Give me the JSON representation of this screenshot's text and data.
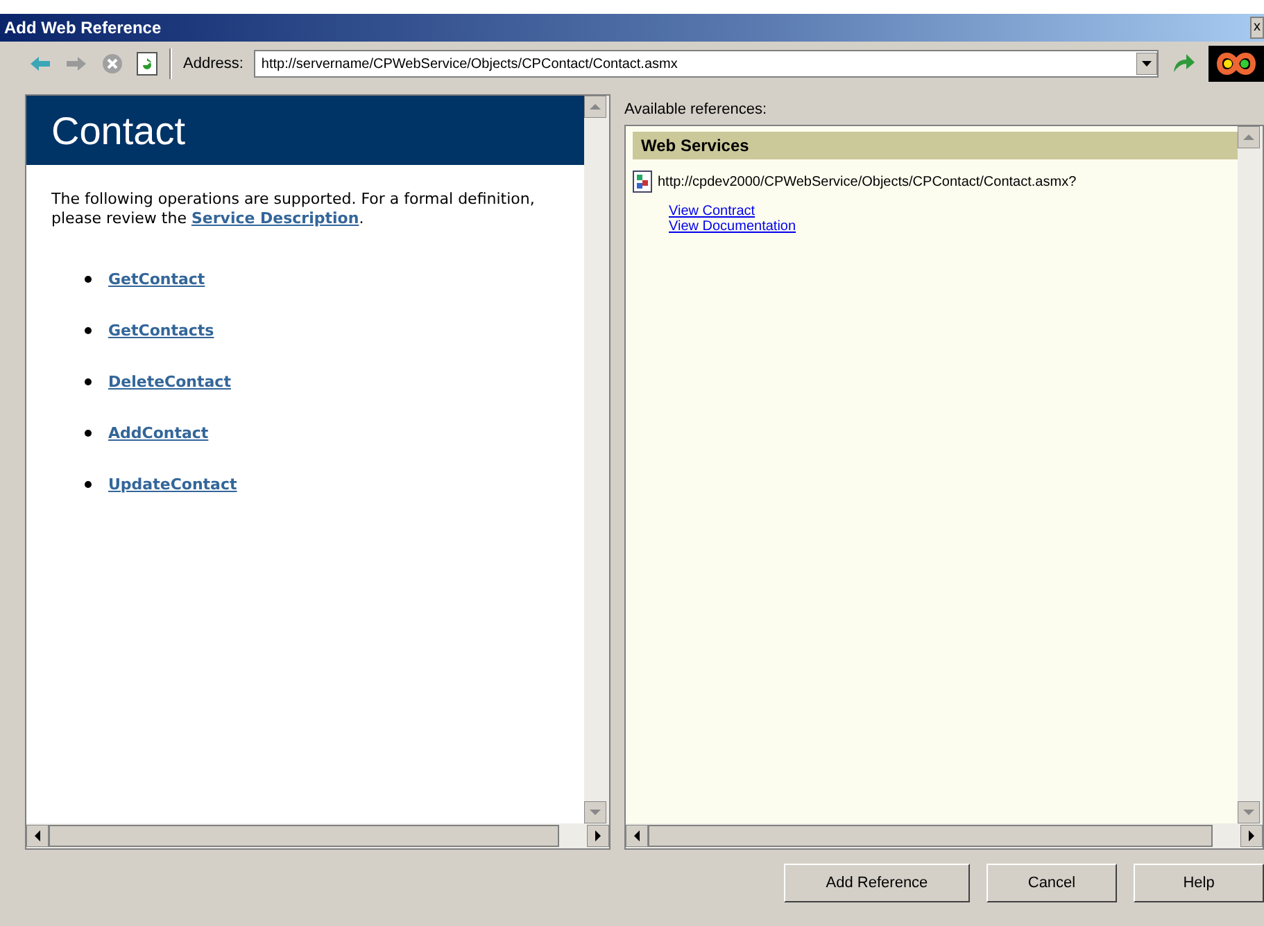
{
  "window": {
    "title": "Add Web Reference",
    "close": "x"
  },
  "toolbar": {
    "address_label": "Address:",
    "address": "http://servername/CPWebService/Objects/CPContact/Contact.asmx"
  },
  "browser": {
    "heading": "Contact",
    "intro": "The following operations are supported. For a formal definition, please review the ",
    "intro_link": "Service Description",
    "intro_end": ".",
    "operations": [
      "GetContact",
      "GetContacts",
      "DeleteContact",
      "AddContact",
      "UpdateContact"
    ]
  },
  "references": {
    "label": "Available references:",
    "group": "Web Services",
    "url": "http://cpdev2000/CPWebService/Objects/CPContact/Contact.asmx?",
    "links": [
      "View Contract",
      "View Documentation"
    ]
  },
  "buttons": [
    "Add Reference",
    "Cancel",
    "Help"
  ]
}
